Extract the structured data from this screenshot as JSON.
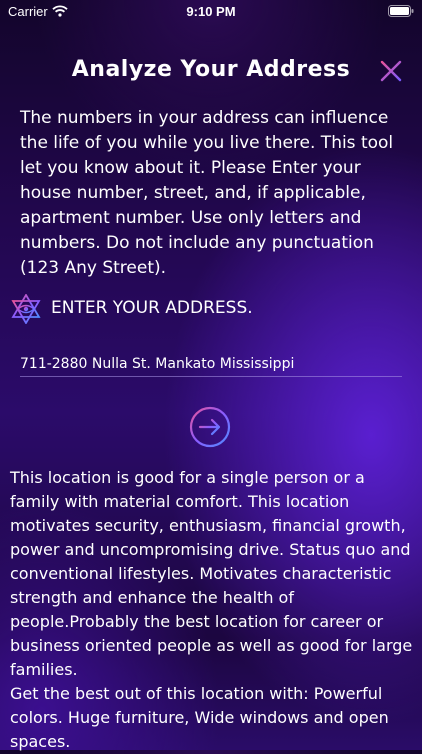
{
  "status_bar": {
    "carrier": "Carrier",
    "time": "9:10 PM"
  },
  "header": {
    "title": "Analyze Your Address"
  },
  "intro": {
    "text": "The numbers in your address can influence the life of you while you live there. This tool let you know about it. Please Enter your house number, street, and, if applicable, apartment number. Use only letters and numbers. Do not include any punctuation (123 Any Street)."
  },
  "address": {
    "label": "ENTER YOUR ADDRESS.",
    "value": "711-2880 Nulla St. Mankato Mississippi"
  },
  "result": {
    "text": "This location is good for a single person or a family with material comfort. This location motivates security, enthusiasm, financial growth, power and uncompromising drive. Status quo and conventional lifestyles. Motivates characteristic strength and enhance the health of people.Probably the best location for career or business oriented people as well as good for large families.\n Get the best out of this location with: Powerful colors. Huge furniture, Wide windows and open spaces."
  },
  "colors": {
    "accent_pink": "#e8549a",
    "accent_purple": "#8a5cff",
    "accent_blue": "#5a8cff"
  },
  "icons": [
    "wifi-icon",
    "battery-icon",
    "close-icon",
    "star-of-david-eye-icon",
    "arrow-right-circle-icon"
  ]
}
